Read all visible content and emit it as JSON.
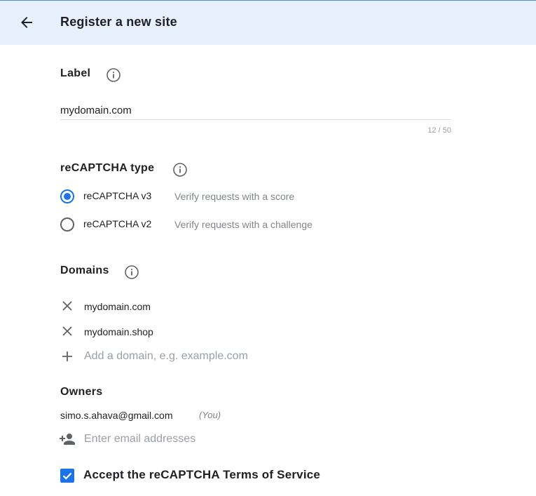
{
  "header": {
    "title": "Register a new site",
    "back_icon": "arrow-back-icon"
  },
  "label_section": {
    "title": "Label",
    "value": "mydomain.com",
    "char_count": "12 / 50"
  },
  "type_section": {
    "title": "reCAPTCHA type",
    "options": [
      {
        "label": "reCAPTCHA v3",
        "description": "Verify requests with a score",
        "selected": true
      },
      {
        "label": "reCAPTCHA v2",
        "description": "Verify requests with a challenge",
        "selected": false
      }
    ]
  },
  "domains_section": {
    "title": "Domains",
    "domains": [
      "mydomain.com",
      "mydomain.shop"
    ],
    "add_placeholder": "Add a domain, e.g. example.com"
  },
  "owners_section": {
    "title": "Owners",
    "owners": [
      {
        "email": "simo.s.ahava@gmail.com",
        "note": "(You)"
      }
    ],
    "add_placeholder": "Enter email addresses"
  },
  "terms": {
    "label": "Accept the reCAPTCHA Terms of Service",
    "checked": true
  },
  "colors": {
    "accent": "#1a73e8",
    "header_bg": "#e8f0fe",
    "muted": "#80868b"
  }
}
